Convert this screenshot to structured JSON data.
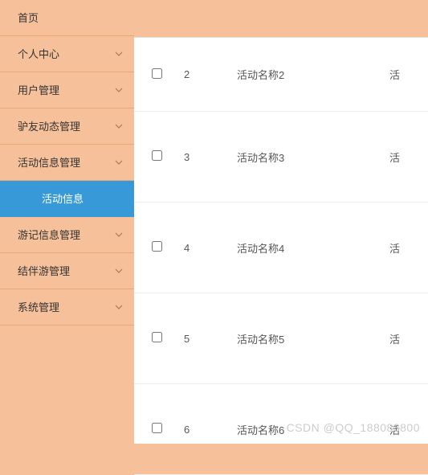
{
  "sidebar": {
    "items": [
      {
        "label": "首页",
        "expandable": false
      },
      {
        "label": "个人中心",
        "expandable": true
      },
      {
        "label": "用户管理",
        "expandable": true
      },
      {
        "label": "驴友动态管理",
        "expandable": true
      },
      {
        "label": "活动信息管理",
        "expandable": true
      },
      {
        "label": "活动信息",
        "expandable": false,
        "active": true
      },
      {
        "label": "游记信息管理",
        "expandable": true
      },
      {
        "label": "结伴游管理",
        "expandable": true
      },
      {
        "label": "系统管理",
        "expandable": true
      }
    ]
  },
  "table": {
    "rows": [
      {
        "num": "2",
        "name": "活动名称2",
        "extra": "活"
      },
      {
        "num": "3",
        "name": "活动名称3",
        "extra": "活"
      },
      {
        "num": "4",
        "name": "活动名称4",
        "extra": "活"
      },
      {
        "num": "5",
        "name": "活动名称5",
        "extra": "活"
      },
      {
        "num": "6",
        "name": "活动名称6",
        "extra": "活"
      }
    ]
  },
  "watermark": "CSDN @QQ_188083800"
}
